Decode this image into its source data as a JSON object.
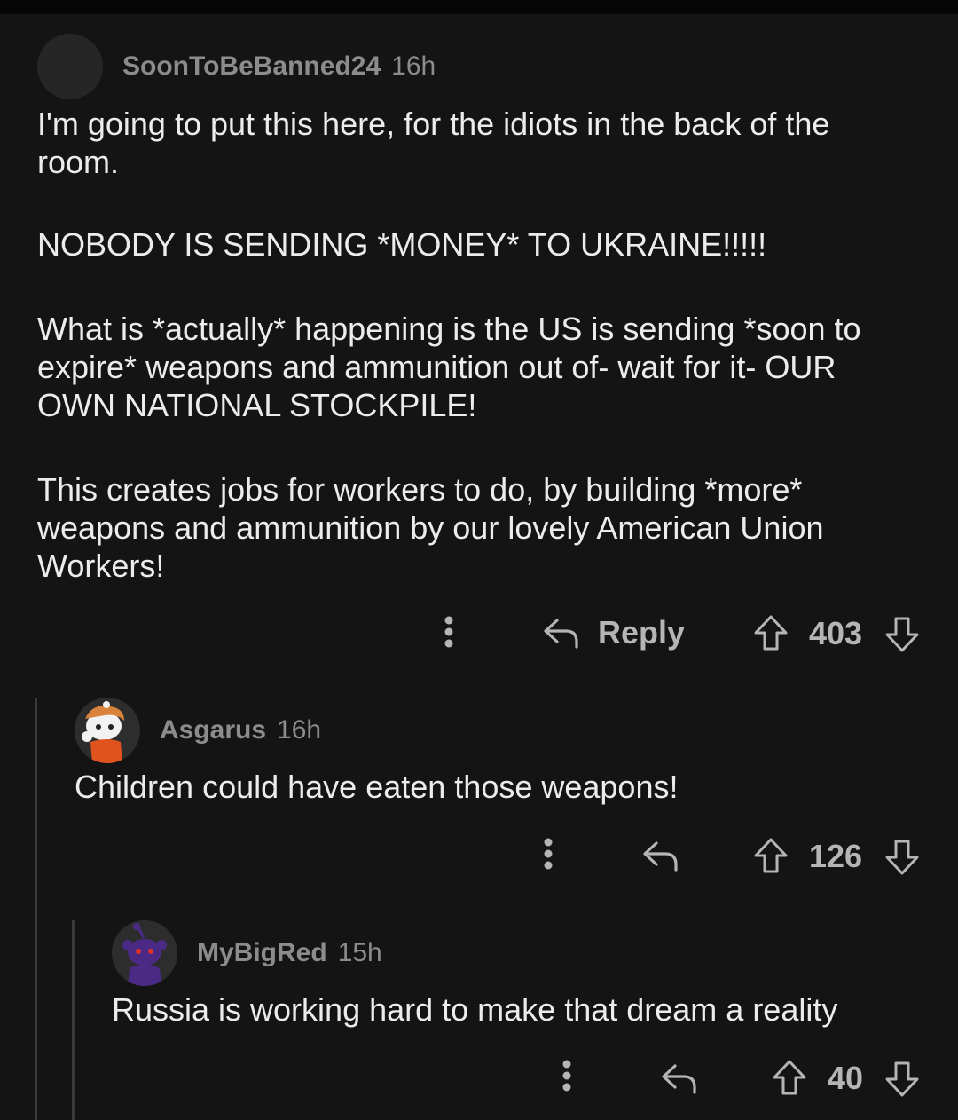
{
  "comments": [
    {
      "username": "SoonToBeBanned24",
      "time": "16h",
      "paragraphs": [
        "I'm going to put this here, for the idiots in the back of the room.",
        "NOBODY IS SENDING *MONEY* TO UKRAINE!!!!!",
        "What is *actually* happening is the US is sending *soon to expire* weapons and ammunition out of- wait for it- OUR OWN NATIONAL STOCKPILE!",
        "This creates jobs for workers to do, by building *more* weapons and ammunition by our lovely American Union Workers!"
      ],
      "reply_label": "Reply",
      "score": "403"
    },
    {
      "username": "Asgarus",
      "time": "16h",
      "text": "Children could have eaten those weapons!",
      "score": "126"
    },
    {
      "username": "MyBigRed",
      "time": "15h",
      "text": "Russia is working hard to make that dream a reality",
      "score": "40"
    }
  ],
  "icons": [
    "more-options-icon",
    "reply-arrow-icon",
    "upvote-arrow-icon",
    "downvote-arrow-icon",
    "user-avatar-icon",
    "snoo-avatar-icon"
  ],
  "colors": {
    "background": "#141414",
    "text": "#ececec",
    "meta": "#8c8c8c",
    "thread_line": "#3a3a3a"
  }
}
